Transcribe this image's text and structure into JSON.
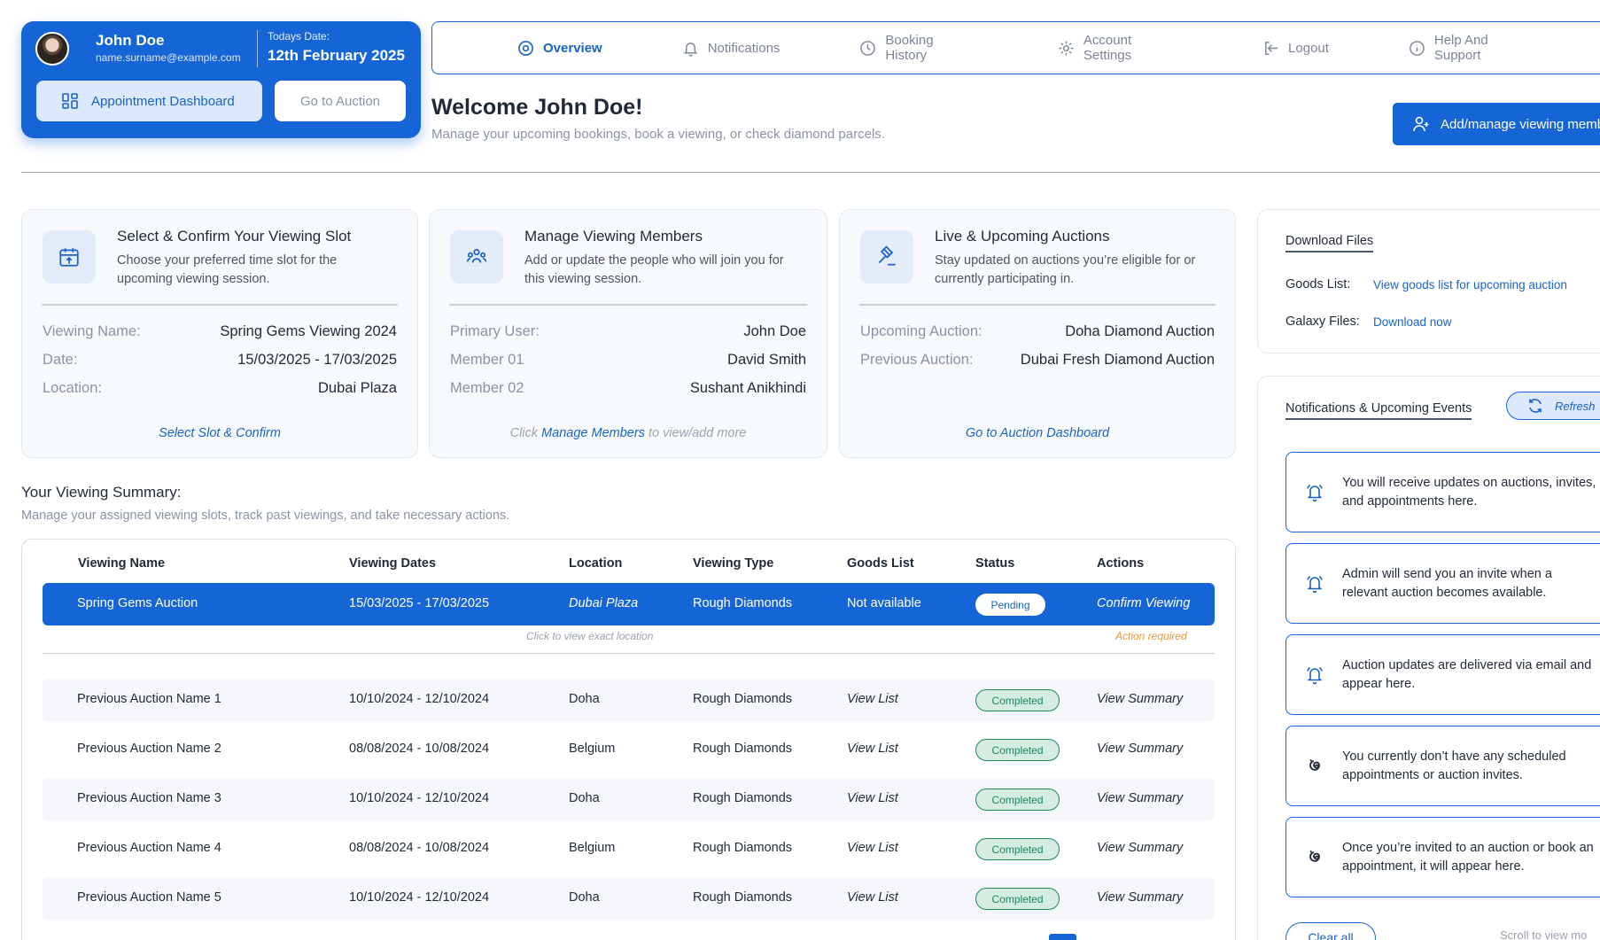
{
  "profile": {
    "name": "John Doe",
    "email": "name.surname@example.com",
    "date_label": "Todays Date:",
    "date": "12th February 2025",
    "dashboard_button": "Appointment Dashboard",
    "auction_button": "Go to Auction"
  },
  "nav": {
    "items": [
      {
        "label": "Overview",
        "icon": "target-icon",
        "active": true
      },
      {
        "label": "Notifications",
        "icon": "bell-icon"
      },
      {
        "label": "Booking History",
        "icon": "clock-icon"
      },
      {
        "label": "Account Settings",
        "icon": "gear-icon"
      },
      {
        "label": "Logout",
        "icon": "logout-icon"
      },
      {
        "label": "Help And Support",
        "icon": "info-icon"
      }
    ]
  },
  "header": {
    "welcome": "Welcome John Doe!",
    "subtitle": "Manage your upcoming bookings, book a viewing, or check diamond parcels.",
    "add_button": "Add/manage viewing memb"
  },
  "cards": [
    {
      "title": "Select & Confirm Your Viewing Slot",
      "desc": "Choose your preferred time slot for the upcoming viewing session.",
      "rows": [
        {
          "k": "Viewing Name:",
          "v": "Spring Gems Viewing 2024"
        },
        {
          "k": "Date:",
          "v": "15/03/2025 - 17/03/2025"
        },
        {
          "k": "Location:",
          "v": "Dubai Plaza"
        }
      ],
      "link": "Select Slot & Confirm"
    },
    {
      "title": "Manage Viewing Members",
      "desc": "Add or update the people who will join you for this viewing session.",
      "rows": [
        {
          "k": "Primary User:",
          "v": "John Doe"
        },
        {
          "k": "Member 01",
          "v": "David Smith"
        },
        {
          "k": "Member 02",
          "v": "Sushant Anikhindi"
        }
      ],
      "link_pre": "Click",
      "link": "Manage Members",
      "link_post": "to view/add more"
    },
    {
      "title": "Live & Upcoming Auctions",
      "desc": "Stay updated on auctions you’re eligible for or currently participating in.",
      "rows": [
        {
          "k": "Upcoming Auction:",
          "v": "Doha Diamond Auction"
        },
        {
          "k": "Previous Auction:",
          "v": "Dubai Fresh Diamond Auction"
        }
      ],
      "link": "Go to Auction Dashboard"
    }
  ],
  "summary": {
    "title": "Your Viewing Summary:",
    "subtitle": "Manage your assigned viewing slots, track past viewings, and take necessary actions.",
    "columns": [
      "Viewing Name",
      "Viewing Dates",
      "Location",
      "Viewing Type",
      "Goods List",
      "Status",
      "Actions"
    ],
    "selected": {
      "name": "Spring Gems Auction",
      "dates": "15/03/2025 - 17/03/2025",
      "location": "Dubai Plaza",
      "type": "Rough Diamonds",
      "goods": "Not available",
      "status": "Pending",
      "action": "Confirm Viewing",
      "location_hint": "Click to view exact location",
      "action_hint": "Action required"
    },
    "rows": [
      {
        "name": "Previous Auction Name 1",
        "dates": "10/10/2024 - 12/10/2024",
        "location": "Doha",
        "type": "Rough Diamonds",
        "goods": "View List",
        "status": "Completed",
        "action": "View Summary"
      },
      {
        "name": "Previous Auction Name 2",
        "dates": "08/08/2024 - 10/08/2024",
        "location": "Belgium",
        "type": "Rough Diamonds",
        "goods": "View List",
        "status": "Completed",
        "action": "View Summary"
      },
      {
        "name": "Previous Auction Name 3",
        "dates": "10/10/2024 - 12/10/2024",
        "location": "Doha",
        "type": "Rough Diamonds",
        "goods": "View List",
        "status": "Completed",
        "action": "View Summary"
      },
      {
        "name": "Previous Auction Name 4",
        "dates": "08/08/2024 - 10/08/2024",
        "location": "Belgium",
        "type": "Rough Diamonds",
        "goods": "View List",
        "status": "Completed",
        "action": "View Summary"
      },
      {
        "name": "Previous Auction Name 5",
        "dates": "10/10/2024 - 12/10/2024",
        "location": "Doha",
        "type": "Rough Diamonds",
        "goods": "View List",
        "status": "Completed",
        "action": "View Summary"
      }
    ]
  },
  "downloads": {
    "title": "Download Files",
    "goods_label": "Goods List:",
    "goods_link": "View goods list for upcoming auction",
    "galaxy_label": "Galaxy Files:",
    "galaxy_link": "Download now"
  },
  "notifications": {
    "title": "Notifications & Upcoming Events",
    "refresh": "Refresh",
    "items": [
      {
        "text": "You will receive updates on auctions, invites, and appointments here.",
        "icon": "bell-icon"
      },
      {
        "text": "Admin will send you an invite when a relevant auction becomes available.",
        "icon": "bell-icon"
      },
      {
        "text": "Auction updates are delivered via email and appear here.",
        "icon": "bell-icon"
      },
      {
        "text": "You currently don’t have any scheduled appointments or auction invites.",
        "icon": "spiral-icon"
      },
      {
        "text": "Once you’re invited to an auction or book an appointment, it will appear here.",
        "icon": "spiral-icon"
      }
    ],
    "clear": "Clear all",
    "scroll_hint": "Scroll to view mo"
  },
  "colors": {
    "primary": "#1565d6",
    "success": "#1a8a56",
    "warning": "#e39a3a"
  }
}
